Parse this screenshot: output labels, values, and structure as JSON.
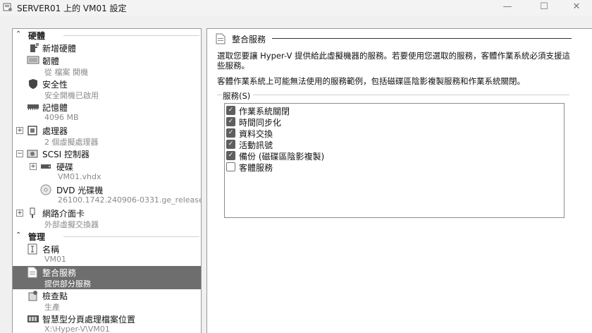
{
  "window": {
    "title": "SERVER01 上的 VM01 設定",
    "min": "—",
    "max": "☐",
    "close": "✕"
  },
  "sidebar": {
    "hardware_label": "硬體",
    "management_label": "管理",
    "items": [
      {
        "label": "新增硬體",
        "sub": ""
      },
      {
        "label": "韌體",
        "sub": "從 檔案 開機"
      },
      {
        "label": "安全性",
        "sub": "安全開機已啟用"
      },
      {
        "label": "記憶體",
        "sub": "4096 MB"
      },
      {
        "label": "處理器",
        "sub": "2 個虛擬處理器"
      },
      {
        "label": "SCSI 控制器",
        "sub": ""
      },
      {
        "label": "硬碟",
        "sub": "VM01.vhdx"
      },
      {
        "label": "DVD 光碟機",
        "sub": "26100.1742.240906-0331.ge_release..."
      },
      {
        "label": "網路介面卡",
        "sub": "外部虛擬交換器"
      },
      {
        "label": "名稱",
        "sub": "VM01"
      },
      {
        "label": "整合服務",
        "sub": "提供部分服務"
      },
      {
        "label": "檢查點",
        "sub": "生產"
      },
      {
        "label": "智慧型分頁處理檔案位置",
        "sub": "X:\\Hyper-V\\VM01"
      }
    ]
  },
  "panel": {
    "title": "整合服務",
    "desc1": "選取您要讓 Hyper-V 提供給此虛擬機器的服務。若要使用您選取的服務，客體作業系統必須支援這些服務。",
    "desc2": "客體作業系統上可能無法使用的服務範例，包括磁碟區陰影複製服務和作業系統關閉。",
    "services_label": "服務(S)",
    "services": [
      {
        "label": "作業系統關閉",
        "checked": true
      },
      {
        "label": "時間同步化",
        "checked": true
      },
      {
        "label": "資料交換",
        "checked": true
      },
      {
        "label": "活動訊號",
        "checked": true
      },
      {
        "label": "備份 (磁碟區陰影複製)",
        "checked": true
      },
      {
        "label": "客體服務",
        "checked": false
      }
    ]
  }
}
